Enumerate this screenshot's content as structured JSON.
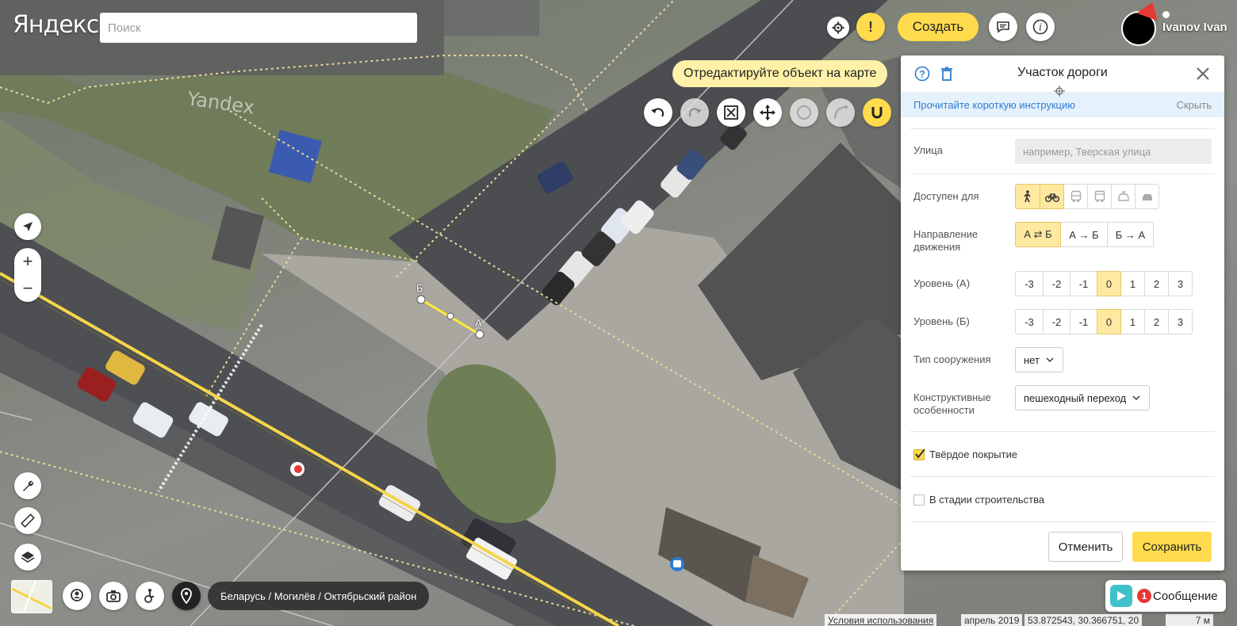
{
  "app": {
    "logo": "Яндекс",
    "watermark": "Yandex"
  },
  "search": {
    "placeholder": "Поиск",
    "value": ""
  },
  "header": {
    "create_label": "Создать",
    "username": "Ivanov Ivan"
  },
  "editor": {
    "hint": "Отредактируйте объект на карте"
  },
  "map_labels": {
    "point_a": "А",
    "point_b": "Б"
  },
  "breadcrumb": "Беларусь / Могилёв / Октябрьский район",
  "status_bar": {
    "terms": "Условия использования",
    "imagery_date": "апрель 2019",
    "coordinates": "53.872543, 30.366751, 20",
    "scale": "7 м"
  },
  "messages": {
    "count": "1",
    "label": "Сообщение"
  },
  "panel": {
    "title": "Участок дороги",
    "instruction_link": "Прочитайте короткую инструкцию",
    "hide_label": "Скрыть",
    "street": {
      "label": "Улица",
      "placeholder": "например, Тверская улица"
    },
    "access": {
      "label": "Доступен для",
      "modes": [
        "пешеход",
        "велосипед",
        "автобус",
        "грузовик",
        "такси",
        "автомобиль"
      ],
      "active": [
        0,
        1
      ]
    },
    "direction": {
      "label": "Направление движения",
      "options": [
        "А ⇄ Б",
        "А → Б",
        "Б → А"
      ],
      "selected": "А ⇄ Б"
    },
    "level_a": {
      "label": "Уровень (А)",
      "options": [
        "-3",
        "-2",
        "-1",
        "0",
        "1",
        "2",
        "3"
      ],
      "selected": "0"
    },
    "level_b": {
      "label": "Уровень (Б)",
      "options": [
        "-3",
        "-2",
        "-1",
        "0",
        "1",
        "2",
        "3"
      ],
      "selected": "0"
    },
    "structure_type": {
      "label": "Тип сооружения",
      "value": "нет"
    },
    "features": {
      "label": "Конструктивные особенности",
      "value": "пешеходный переход"
    },
    "hard_surface": {
      "label": "Твёрдое покрытие",
      "checked": true
    },
    "under_construction": {
      "label": "В стадии строительства",
      "checked": false
    },
    "cancel_label": "Отменить",
    "save_label": "Сохранить"
  },
  "colors": {
    "accent": "#ffdb4d",
    "link": "#2c7cd0",
    "instruction_bg": "#e5f1fb",
    "selected_segment": "#ffe8a0"
  }
}
